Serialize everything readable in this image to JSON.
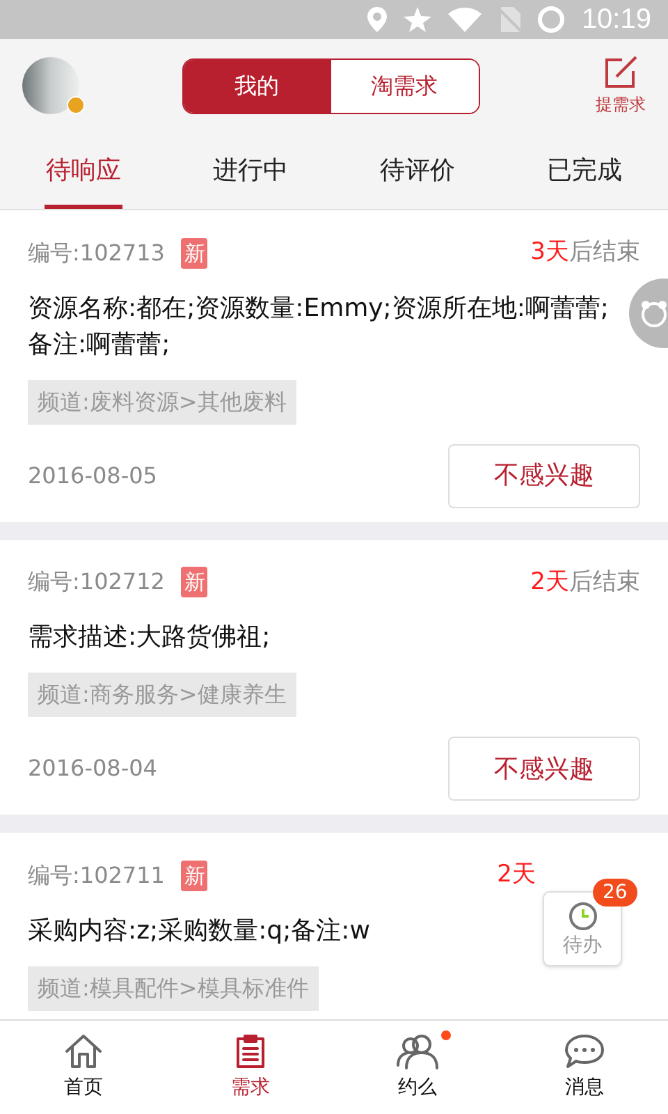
{
  "status_bar": {
    "time": "10:19"
  },
  "header": {
    "segments": [
      {
        "label": "我的",
        "selected": true
      },
      {
        "label": "淘需求",
        "selected": false
      }
    ],
    "post_label": "提需求"
  },
  "tabs": [
    {
      "label": "待响应",
      "selected": true
    },
    {
      "label": "进行中",
      "selected": false
    },
    {
      "label": "待评价",
      "selected": false
    },
    {
      "label": "已完成",
      "selected": false
    }
  ],
  "cards": [
    {
      "number": "编号:102713",
      "badge": "新",
      "end_days": "3天",
      "end_suffix": "后结束",
      "description": "资源名称:都在;资源数量:Emmy;资源所在地:啊蕾蕾;备注:啊蕾蕾;",
      "channel": "频道:废料资源>其他废料",
      "date": "2016-08-05",
      "action": "不感兴趣"
    },
    {
      "number": "编号:102712",
      "badge": "新",
      "end_days": "2天",
      "end_suffix": "后结束",
      "description": "需求描述:大路货佛祖;",
      "channel": "频道:商务服务>健康养生",
      "date": "2016-08-04",
      "action": "不感兴趣"
    },
    {
      "number": "编号:102711",
      "badge": "新",
      "end_days": "2天",
      "description": "采购内容:z;采购数量:q;备注:w",
      "channel": "频道:模具配件>模具标准件"
    }
  ],
  "todo_widget": {
    "label": "待办",
    "count": "26"
  },
  "bottom_nav": [
    {
      "label": "首页",
      "selected": false,
      "dot": false
    },
    {
      "label": "需求",
      "selected": true,
      "dot": false
    },
    {
      "label": "约么",
      "selected": false,
      "dot": true
    },
    {
      "label": "消息",
      "selected": false,
      "dot": false
    }
  ]
}
